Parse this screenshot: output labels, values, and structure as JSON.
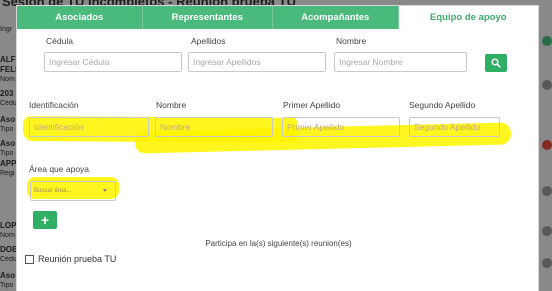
{
  "background": {
    "title_fragment": "Sesión de TU Incompletos - Reunión prueba TU",
    "left_snippets": [
      {
        "text": "Ingr",
        "bold": false
      },
      {
        "text": "ALF",
        "bold": true
      },
      {
        "text": "FELI",
        "bold": true
      },
      {
        "text": "Nom",
        "bold": false
      },
      {
        "text": "203",
        "bold": true
      },
      {
        "text": "Cédu",
        "bold": false
      },
      {
        "text": "Aso",
        "bold": true
      },
      {
        "text": "Tipo",
        "bold": false
      },
      {
        "text": "Aso",
        "bold": true
      },
      {
        "text": "Tipo",
        "bold": false
      },
      {
        "text": "APP",
        "bold": true
      },
      {
        "text": "Regi",
        "bold": false
      },
      {
        "text": "LOP",
        "bold": true
      },
      {
        "text": "Nom",
        "bold": false
      },
      {
        "text": "DOB",
        "bold": true
      },
      {
        "text": "Cédu",
        "bold": false
      },
      {
        "text": "Aso",
        "bold": true
      },
      {
        "text": "Tipo",
        "bold": false
      }
    ]
  },
  "tabs": [
    {
      "label": "Asociados",
      "active": false
    },
    {
      "label": "Representantes",
      "active": false
    },
    {
      "label": "Acompañantes",
      "active": false
    },
    {
      "label": "Equipo de apoyo",
      "active": true
    }
  ],
  "search": {
    "cedula_label": "Cédula",
    "cedula_placeholder": "Ingresar Cédula",
    "apellidos_label": "Apellidos",
    "apellidos_placeholder": "Ingresar Apellidos",
    "nombre_label": "Nombre",
    "nombre_placeholder": "Ingresar Nombre",
    "search_icon": "search-icon"
  },
  "form": {
    "identificacion_label": "Identificación",
    "identificacion_placeholder": "Identificación",
    "nombre_label": "Nombre",
    "nombre_placeholder": "Nombre",
    "primer_apellido_label": "Primer Apellido",
    "primer_apellido_placeholder": "Primer Apellido",
    "segundo_apellido_label": "Segundo Apellido",
    "segundo_apellido_placeholder": "Segundo Apellido",
    "area_label": "Área que apoya",
    "area_placeholder": "Buscar área...",
    "add_label": "+"
  },
  "participation": {
    "text": "Participa en la(s) siguiente(s) reunion(es)",
    "meetings": [
      {
        "label": "Reunión prueba TU",
        "checked": false
      }
    ]
  },
  "colors": {
    "accent": "#49ba7c",
    "button": "#2fae66",
    "highlight": "#fff500",
    "background_alert": "#e04b3a"
  }
}
